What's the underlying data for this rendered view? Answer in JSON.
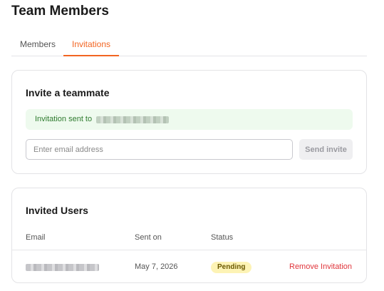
{
  "page": {
    "title": "Team Members"
  },
  "tabs": [
    {
      "label": "Members",
      "active": false
    },
    {
      "label": "Invitations",
      "active": true
    }
  ],
  "invite": {
    "heading": "Invite a teammate",
    "alert_text": "Invitation sent to",
    "email_placeholder": "Enter email address",
    "email_value": "",
    "send_label": "Send invite"
  },
  "invited_users": {
    "heading": "Invited Users",
    "columns": [
      "Email",
      "Sent on",
      "Status"
    ],
    "rows": [
      {
        "sent_on": "May 7, 2026",
        "status": "Pending",
        "action": "Remove Invitation"
      }
    ]
  },
  "colors": {
    "accent": "#f26522",
    "success_bg": "#eefaee",
    "success_text": "#2d7a2d",
    "pending_bg": "#fdf3b5",
    "danger": "#e0353b"
  }
}
